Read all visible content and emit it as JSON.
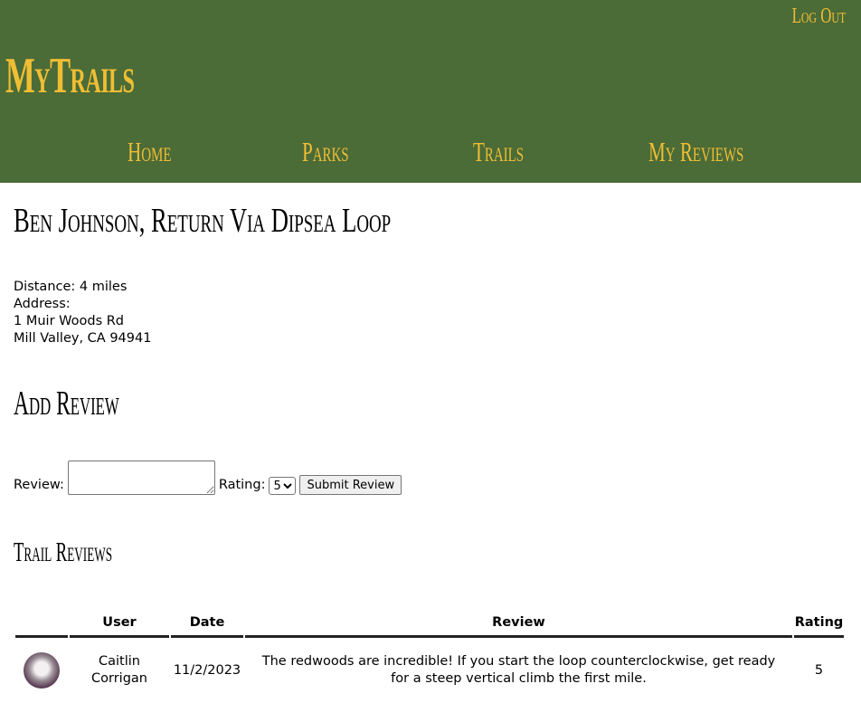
{
  "header": {
    "logout": "Log Out",
    "logo": "MyTrails",
    "nav": [
      "Home",
      "Parks",
      "Trails",
      "My Reviews"
    ]
  },
  "trail": {
    "title": "Ben Johnson, Return Via Dipsea Loop",
    "distance": "Distance: 4 miles",
    "address_label": "Address:",
    "address_line1": "1 Muir Woods Rd",
    "address_line2": "Mill Valley, CA 94941"
  },
  "add_review": {
    "heading": "Add Review",
    "review_label": "Review:",
    "review_value": "",
    "rating_label": "Rating:",
    "rating_value": "5",
    "submit_label": "Submit Review"
  },
  "reviews": {
    "heading": "Trail Reviews",
    "columns": [
      "",
      "User",
      "Date",
      "Review",
      "Rating"
    ],
    "rows": [
      {
        "user": "Caitlin Corrigan",
        "date": "11/2/2023",
        "review": "The redwoods are incredible! If you start the loop counterclockwise, get ready for a steep vertical climb the first mile.",
        "rating": "5"
      }
    ]
  },
  "colors": {
    "header_bg": "#4b6b37",
    "accent": "#f0be34"
  }
}
